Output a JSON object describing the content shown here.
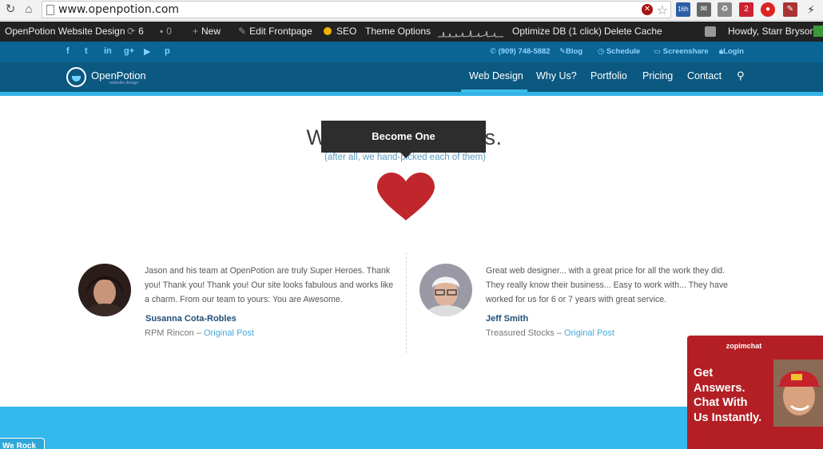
{
  "browser": {
    "url": "www.openpotion.com",
    "ext_badge_1": "16h",
    "ext_badge_2": "2"
  },
  "wp_admin_bar": {
    "site_name": "OpenPotion Website Design",
    "updates_count": "6",
    "comments_count": "0",
    "new_label": "New",
    "edit_label": "Edit Frontpage",
    "seo_label": "SEO",
    "theme_options_label": "Theme Options",
    "optimize_label": "Optimize DB (1 click)",
    "delete_cache_label": "Delete Cache",
    "howdy_label": "Howdy, Starr Bryson",
    "seo_color": "#f0b400"
  },
  "topbar": {
    "social_icons": [
      "facebook-icon",
      "twitter-icon",
      "linkedin-icon",
      "googleplus-icon",
      "youtube-icon",
      "pinterest-icon"
    ],
    "phone": "(909) 748-5882",
    "blog": "Blog",
    "schedule": "Schedule",
    "screenshare": "Screenshare",
    "login": "Login"
  },
  "header": {
    "logo_name": "OpenPotion",
    "logo_sub": "website design",
    "nav": [
      "Web Design",
      "Why Us?",
      "Portfolio",
      "Pricing",
      "Contact"
    ],
    "active_nav": "Web Design",
    "accent_color": "#33b3e6"
  },
  "hero": {
    "title": "We love our clients.",
    "subtitle": "(after all, we hand-picked each of them)",
    "tooltip": "Become One",
    "heart_color": "#c0272d"
  },
  "testimonials": [
    {
      "text": "Jason and his team at OpenPotion are truly Super Heroes. Thank you! Thank you! Thank you! Our site looks fabulous and works like a charm. From our team to yours: You are Awesome.",
      "name": "Susanna Cota-Robles",
      "company": "RPM Rincon",
      "link": "Original Post"
    },
    {
      "text": "Great web designer... with a great price for all the work they did. They really know their business... Easy to work with... They have worked for us for 6 or 7 years with great service.",
      "name": "Jeff Smith",
      "company": "Treasured Stocks",
      "link": "Original Post"
    }
  ],
  "footer": {
    "back_tab": "We Rock"
  },
  "chat": {
    "brand": "zopimchat",
    "line1": "Get",
    "line2": "Answers.",
    "line3": "Chat With",
    "line4": "Us Instantly."
  }
}
